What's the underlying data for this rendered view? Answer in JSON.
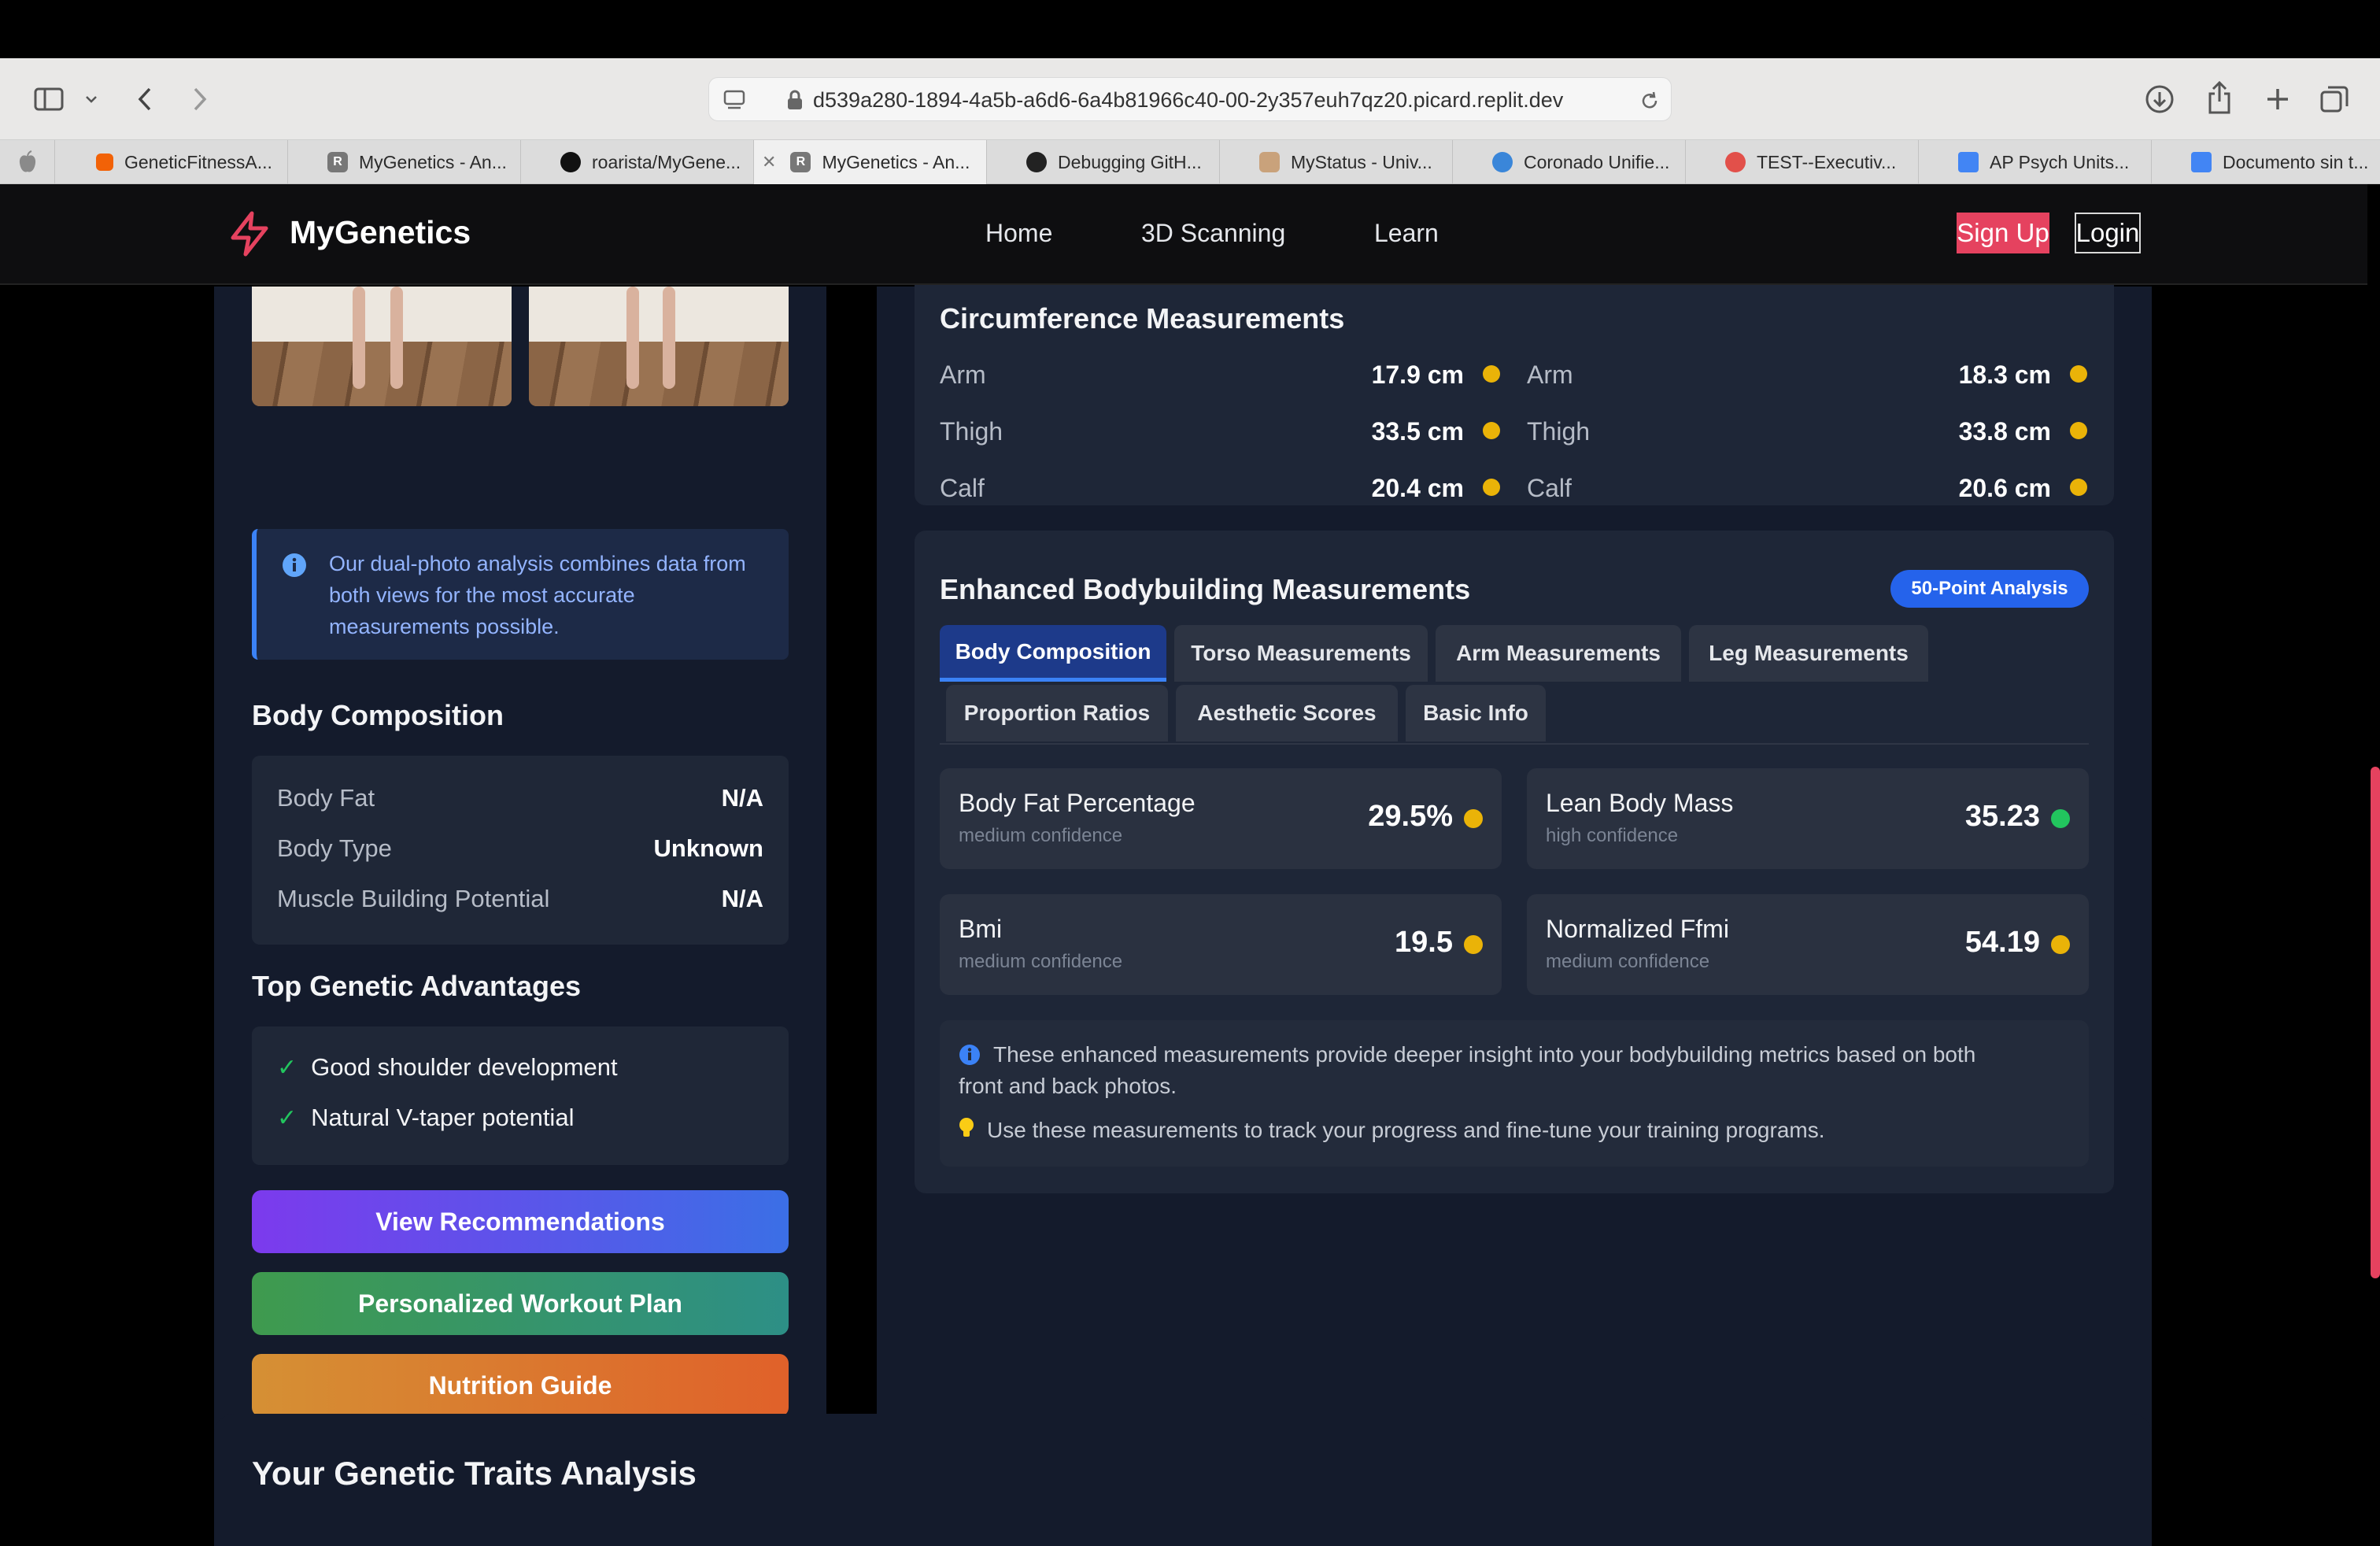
{
  "browser": {
    "url": "d539a280-1894-4a5b-a6d6-6a4b81966c40-00-2y357euh7qz20.picard.replit.dev",
    "tabs": [
      {
        "label": "GeneticFitnessA..."
      },
      {
        "label": "MyGenetics - An..."
      },
      {
        "label": "roarista/MyGene..."
      },
      {
        "label": "MyGenetics - An..."
      },
      {
        "label": "Debugging GitH..."
      },
      {
        "label": "MyStatus - Univ..."
      },
      {
        "label": "Coronado Unifie..."
      },
      {
        "label": "TEST--Executiv..."
      },
      {
        "label": "AP Psych Units..."
      },
      {
        "label": "Documento sin t..."
      }
    ]
  },
  "nav": {
    "brand": "MyGenetics",
    "links": [
      "Home",
      "3D Scanning",
      "Learn"
    ],
    "signup": "Sign Up",
    "login": "Login",
    "accent": "#e5425f"
  },
  "left": {
    "info_text": "Our dual-photo analysis combines data from both views for the most accurate measurements possible.",
    "body_composition": {
      "title": "Body Composition",
      "rows": [
        {
          "label": "Body Fat",
          "value": "N/A"
        },
        {
          "label": "Body Type",
          "value": "Unknown"
        },
        {
          "label": "Muscle Building Potential",
          "value": "N/A"
        }
      ]
    },
    "advantages": {
      "title": "Top Genetic Advantages",
      "items": [
        "Good shoulder development",
        "Natural V-taper potential"
      ]
    },
    "buttons": {
      "recommendations": "View Recommendations",
      "workout": "Personalized Workout Plan",
      "nutrition": "Nutrition Guide"
    }
  },
  "circumference": {
    "title": "Circumference Measurements",
    "left": [
      {
        "label": "Arm",
        "value": "17.9 cm"
      },
      {
        "label": "Thigh",
        "value": "33.5 cm"
      },
      {
        "label": "Calf",
        "value": "20.4 cm"
      }
    ],
    "right": [
      {
        "label": "Arm",
        "value": "18.3 cm"
      },
      {
        "label": "Thigh",
        "value": "33.8 cm"
      },
      {
        "label": "Calf",
        "value": "20.6 cm"
      }
    ]
  },
  "enhanced": {
    "title": "Enhanced Bodybuilding Measurements",
    "badge": "50-Point Analysis",
    "tabs": [
      "Body Composition",
      "Torso Measurements",
      "Arm Measurements",
      "Leg Measurements",
      "Proportion Ratios",
      "Aesthetic Scores",
      "Basic Info"
    ],
    "metrics": [
      {
        "name": "Body Fat Percentage",
        "confidence": "medium confidence",
        "value": "29.5%",
        "status_color": "#eab308"
      },
      {
        "name": "Lean Body Mass",
        "confidence": "high confidence",
        "value": "35.23",
        "status_color": "#22c55e"
      },
      {
        "name": "Bmi",
        "confidence": "medium confidence",
        "value": "19.5",
        "status_color": "#eab308"
      },
      {
        "name": "Normalized Ffmi",
        "confidence": "medium confidence",
        "value": "54.19",
        "status_color": "#eab308"
      }
    ],
    "notes": [
      "These enhanced measurements provide deeper insight into your bodybuilding metrics based on both",
      "front and back photos.",
      "Use these measurements to track your progress and fine-tune your training programs."
    ]
  },
  "traits": {
    "title": "Your Genetic Traits Analysis"
  }
}
